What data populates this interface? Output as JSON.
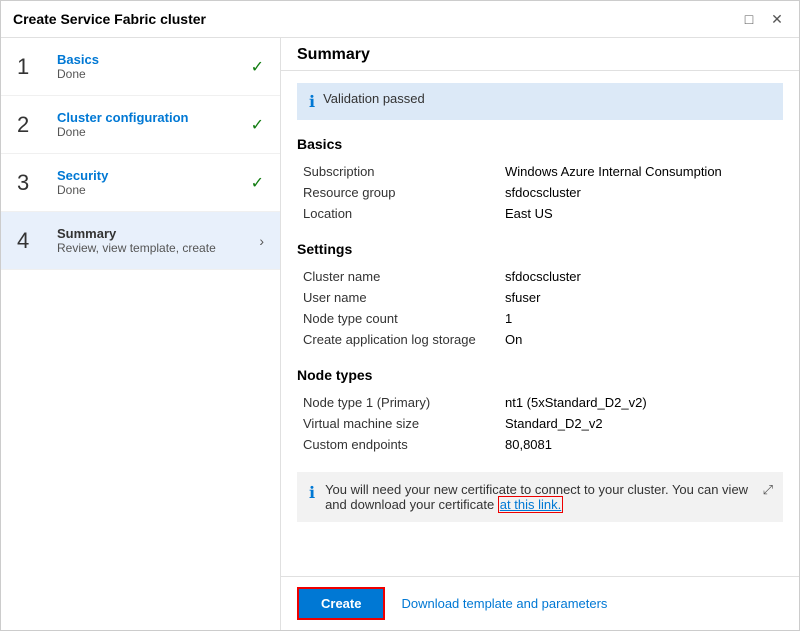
{
  "dialog": {
    "title": "Create Service Fabric cluster",
    "close_icon": "✕",
    "minimize_icon": "□"
  },
  "steps": [
    {
      "number": "1",
      "name": "Basics",
      "sub": "Done",
      "status": "done",
      "active": false
    },
    {
      "number": "2",
      "name": "Cluster configuration",
      "sub": "Done",
      "status": "done",
      "active": false
    },
    {
      "number": "3",
      "name": "Security",
      "sub": "Done",
      "status": "done",
      "active": false
    },
    {
      "number": "4",
      "name": "Summary",
      "sub": "Review, view template, create",
      "status": "active",
      "active": true
    }
  ],
  "right": {
    "title": "Summary",
    "validation_banner": "Validation passed",
    "sections": {
      "basics": {
        "title": "Basics",
        "rows": [
          {
            "label": "Subscription",
            "value": "Windows Azure Internal Consumption"
          },
          {
            "label": "Resource group",
            "value": "sfdocscluster"
          },
          {
            "label": "Location",
            "value": "East US"
          }
        ]
      },
      "settings": {
        "title": "Settings",
        "rows": [
          {
            "label": "Cluster name",
            "value": "sfdocscluster"
          },
          {
            "label": "User name",
            "value": "sfuser"
          },
          {
            "label": "Node type count",
            "value": "1"
          },
          {
            "label": "Create application log storage",
            "value": "On"
          }
        ]
      },
      "node_types": {
        "title": "Node types",
        "rows": [
          {
            "label": "Node type 1 (Primary)",
            "value": "nt1 (5xStandard_D2_v2)"
          },
          {
            "label": "Virtual machine size",
            "value": "Standard_D2_v2"
          },
          {
            "label": "Custom endpoints",
            "value": "80,8081"
          }
        ]
      }
    },
    "cert_banner": {
      "text_before": "You will need your new certificate to connect to your cluster. You can view and download your certificate ",
      "link_text": "at this link.",
      "text_after": "",
      "ext_icon": "⤢"
    },
    "footer": {
      "create_label": "Create",
      "download_label": "Download template and parameters"
    }
  }
}
